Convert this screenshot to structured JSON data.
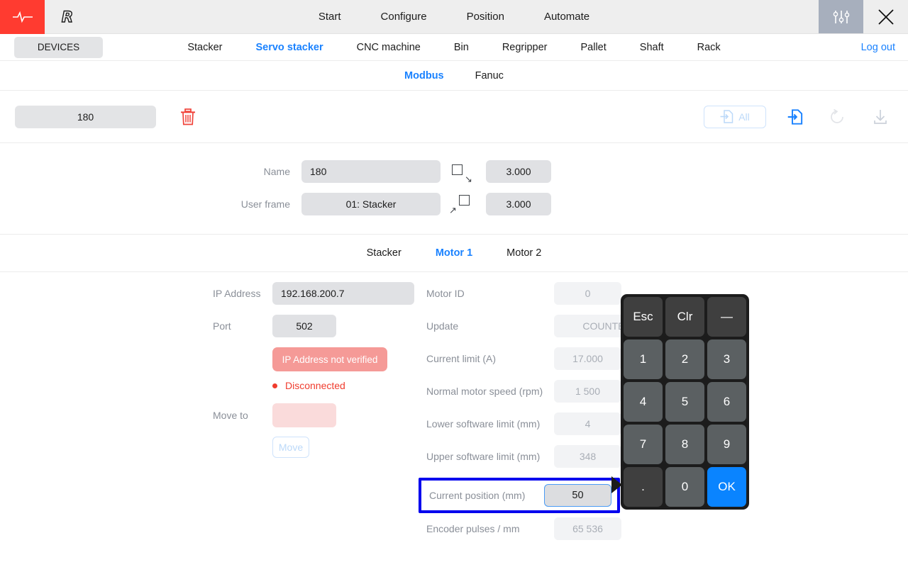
{
  "header": {
    "logo_icon": "pulse-icon",
    "brand_icon": "r-logo",
    "nav": [
      {
        "label": "Start"
      },
      {
        "label": "Configure"
      },
      {
        "label": "Position"
      },
      {
        "label": "Automate"
      }
    ],
    "settings_icon": "sliders-icon",
    "close_icon": "close-icon"
  },
  "devices": {
    "chip_label": "DEVICES",
    "tabs": [
      {
        "label": "Stacker",
        "active": false
      },
      {
        "label": "Servo stacker",
        "active": true
      },
      {
        "label": "CNC machine",
        "active": false
      },
      {
        "label": "Bin",
        "active": false
      },
      {
        "label": "Regripper",
        "active": false
      },
      {
        "label": "Pallet",
        "active": false
      },
      {
        "label": "Shaft",
        "active": false
      },
      {
        "label": "Rack",
        "active": false
      }
    ],
    "logout_label": "Log out"
  },
  "protocol_tabs": [
    {
      "label": "Modbus",
      "active": true
    },
    {
      "label": "Fanuc",
      "active": false
    }
  ],
  "toolbar": {
    "program_value": "180",
    "delete_icon": "trash-icon",
    "import_all_label": "All",
    "import_all_icon": "import-file-icon",
    "import_icon": "import-file-icon",
    "undo_icon": "undo-icon",
    "download_icon": "download-icon"
  },
  "meta": {
    "name_label": "Name",
    "name_value": "180",
    "userframe_label": "User frame",
    "userframe_value": "01: Stacker",
    "approach_icon": "approach-corner-icon",
    "approach_value": "3.000",
    "retract_icon": "retract-corner-icon",
    "retract_value": "3.000"
  },
  "motor_tabs": [
    {
      "label": "Stacker",
      "active": false
    },
    {
      "label": "Motor 1",
      "active": true
    },
    {
      "label": "Motor 2",
      "active": false
    }
  ],
  "connection": {
    "ip_label": "IP Address",
    "ip_value": "192.168.200.7",
    "port_label": "Port",
    "port_value": "502",
    "warning": "IP Address not verified",
    "status": "Disconnected",
    "moveto_label": "Move to",
    "moveto_value": "",
    "move_button": "Move"
  },
  "motor_params": [
    {
      "label": "Motor ID",
      "value": "0"
    },
    {
      "label": "Update",
      "value": "COUNTER"
    },
    {
      "label": "Current limit (A)",
      "value": "17.000"
    },
    {
      "label": "Normal motor speed (rpm)",
      "value": "1 500"
    },
    {
      "label": "Lower software limit (mm)",
      "value": "4"
    },
    {
      "label": "Upper software limit (mm)",
      "value": "348"
    },
    {
      "label": "Current position (mm)",
      "value": "50"
    },
    {
      "label": "Encoder pulses / mm",
      "value": "65 536"
    }
  ],
  "keypad": {
    "keys": [
      {
        "label": "Esc",
        "type": "fn"
      },
      {
        "label": "Clr",
        "type": "fn"
      },
      {
        "label": "—",
        "type": "fn"
      },
      {
        "label": "1",
        "type": "num"
      },
      {
        "label": "2",
        "type": "num"
      },
      {
        "label": "3",
        "type": "num"
      },
      {
        "label": "4",
        "type": "num"
      },
      {
        "label": "5",
        "type": "num"
      },
      {
        "label": "6",
        "type": "num"
      },
      {
        "label": "7",
        "type": "num"
      },
      {
        "label": "8",
        "type": "num"
      },
      {
        "label": "9",
        "type": "num"
      },
      {
        "label": ".",
        "type": "fn"
      },
      {
        "label": "0",
        "type": "num"
      },
      {
        "label": "OK",
        "type": "ok"
      }
    ]
  },
  "colors": {
    "accent_blue": "#1a82ff",
    "brand_red": "#ff3b30",
    "error_red": "#f03c2e",
    "warning_pill": "#f59a97",
    "highlight_border": "#0000ee",
    "keypad_ok": "#0a84ff"
  }
}
